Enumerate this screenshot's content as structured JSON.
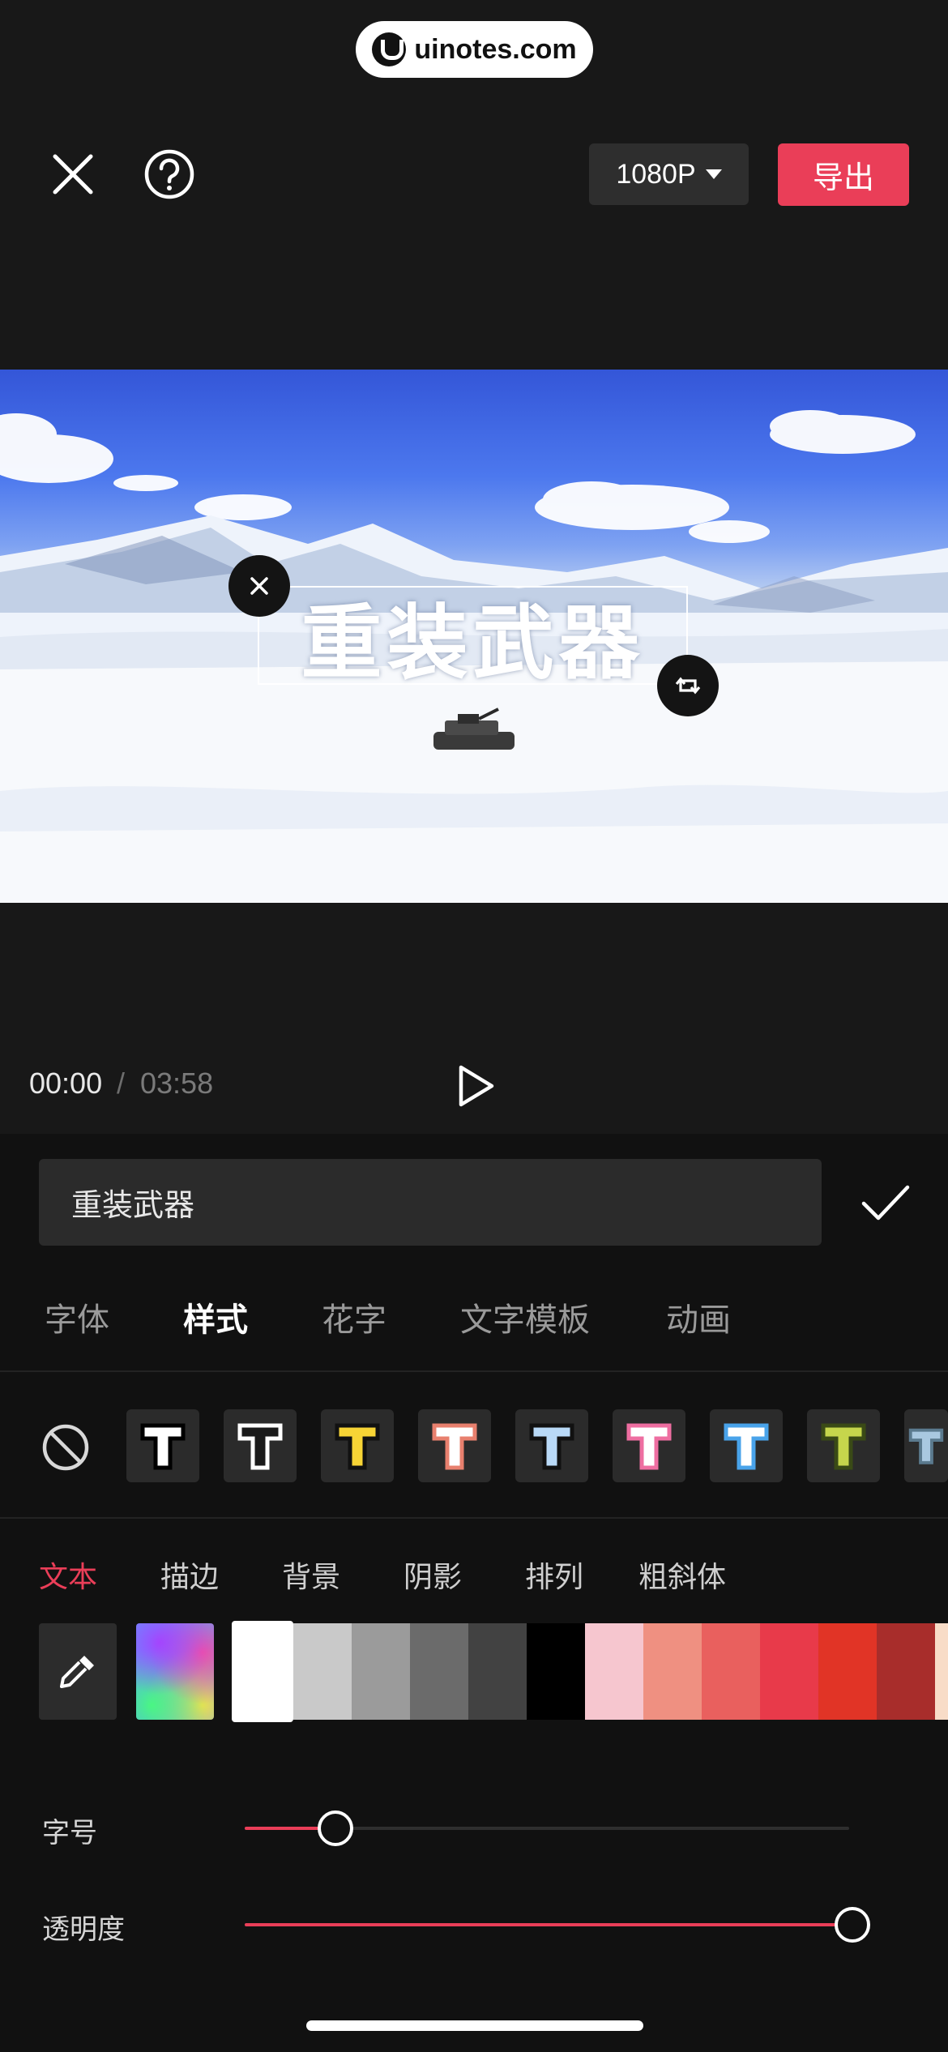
{
  "watermark": {
    "text": "uinotes.com"
  },
  "header": {
    "close_icon": "close-icon",
    "help_icon": "help-icon",
    "resolution": "1080P",
    "export_label": "导出"
  },
  "preview": {
    "overlay_text": "重装武器",
    "delete_icon": "close-icon",
    "rotate_icon": "rotate-scale-icon"
  },
  "playback": {
    "current_time": "00:00",
    "separator": "/",
    "total_time": "03:58",
    "play_icon": "play-icon"
  },
  "editor": {
    "text_value": "重装武器",
    "confirm_icon": "check-icon",
    "tabs": [
      {
        "label": "字体",
        "active": false
      },
      {
        "label": "样式",
        "active": true
      },
      {
        "label": "花字",
        "active": false
      },
      {
        "label": "文字模板",
        "active": false
      },
      {
        "label": "动画",
        "active": false
      }
    ],
    "style_presets": [
      {
        "name": "none",
        "icon": "none-icon"
      },
      {
        "fill": "#ffffff",
        "stroke": "#000000"
      },
      {
        "fill": "#1a1a1a",
        "stroke": "#ffffff"
      },
      {
        "fill": "#f7d435",
        "stroke": "#111111"
      },
      {
        "fill": "#ffffff",
        "stroke": "#e8806e"
      },
      {
        "fill": "#b9d9f7",
        "stroke": "#111111"
      },
      {
        "fill": "#ffffff",
        "stroke": "#ee6ea1"
      },
      {
        "fill": "#ffffff",
        "stroke": "#49a3ea"
      },
      {
        "fill": "#c6d64c",
        "stroke": "#3a4a16"
      },
      {
        "fill": "#a9c8e0",
        "stroke": "#5b7a8e"
      }
    ],
    "sub_tabs": [
      {
        "label": "文本",
        "active": true
      },
      {
        "label": "描边",
        "active": false
      },
      {
        "label": "背景",
        "active": false
      },
      {
        "label": "阴影",
        "active": false
      },
      {
        "label": "排列",
        "active": false
      },
      {
        "label": "粗斜体",
        "active": false
      }
    ],
    "color_picker_icon": "eyedropper-icon",
    "custom_color_icon": "color-gradient-icon",
    "colors": [
      "#ffffff",
      "#c9c9c9",
      "#9b9b9b",
      "#6b6b6b",
      "#424242",
      "#000000",
      "#f6c6cf",
      "#ef9081",
      "#e9605e",
      "#e83a4a",
      "#e13426",
      "#a82d2b",
      "#f8dcc7"
    ],
    "selected_color": "#ffffff",
    "font_size": {
      "label": "字号",
      "value": 0.15
    },
    "opacity": {
      "label": "透明度",
      "value": 1.0
    },
    "accent_color": "#ea3e58"
  }
}
